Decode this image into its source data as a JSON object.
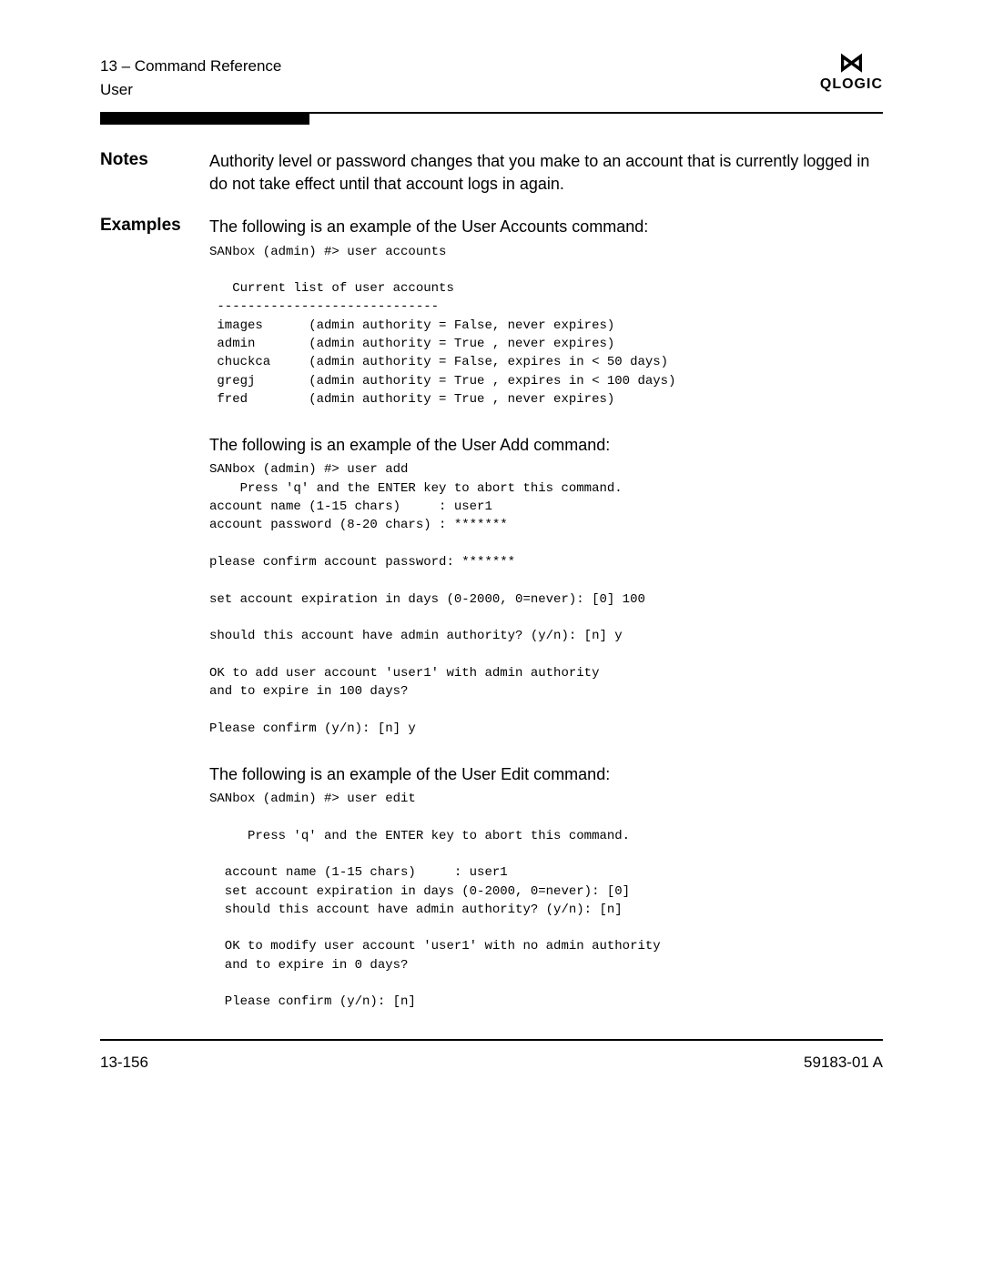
{
  "header": {
    "chapter": "13 – Command Reference",
    "section": "User",
    "logo_top": "⋈",
    "logo_bottom": "QLOGIC"
  },
  "notes": {
    "label": "Notes",
    "text": "Authority level or password changes that you make to an account that is currently logged in do not take effect until that account logs in again."
  },
  "examples": {
    "label": "Examples",
    "accounts": {
      "intro": "The following is an example of the User Accounts command:",
      "code": "SANbox (admin) #> user accounts\n\n   Current list of user accounts\n -----------------------------\n images      (admin authority = False, never expires)\n admin       (admin authority = True , never expires)\n chuckca     (admin authority = False, expires in < 50 days)\n gregj       (admin authority = True , expires in < 100 days)\n fred        (admin authority = True , never expires)"
    },
    "add": {
      "intro": "The following is an example of the User Add command:",
      "code": "SANbox (admin) #> user add\n    Press 'q' and the ENTER key to abort this command.\naccount name (1-15 chars)     : user1\naccount password (8-20 chars) : *******\n\nplease confirm account password: *******\n\nset account expiration in days (0-2000, 0=never): [0] 100\n\nshould this account have admin authority? (y/n): [n] y\n\nOK to add user account 'user1' with admin authority\nand to expire in 100 days?\n\nPlease confirm (y/n): [n] y"
    },
    "edit": {
      "intro": "The following is an example of the User Edit command:",
      "code": "SANbox (admin) #> user edit\n\n     Press 'q' and the ENTER key to abort this command.\n\n  account name (1-15 chars)     : user1\n  set account expiration in days (0-2000, 0=never): [0]\n  should this account have admin authority? (y/n): [n]\n\n  OK to modify user account 'user1' with no admin authority\n  and to expire in 0 days?\n\n  Please confirm (y/n): [n]"
    }
  },
  "footer": {
    "left": "13-156",
    "right": "59183-01 A"
  }
}
